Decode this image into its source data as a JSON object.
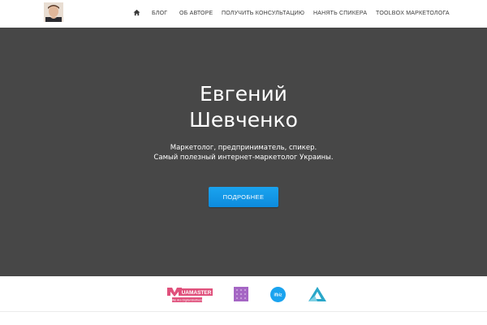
{
  "nav": {
    "home_icon": "home-icon",
    "items": [
      {
        "label": "БЛОГ"
      },
      {
        "label": "ОБ АВТОРЕ"
      },
      {
        "label": "ПОЛУЧИТЬ КОНСУЛЬТАЦИЮ"
      },
      {
        "label": "НАНЯТЬ СПИКЕРА"
      },
      {
        "label": "TOOLBOX МАРКЕТОЛОГА"
      }
    ]
  },
  "hero": {
    "title_line1": "Евгений",
    "title_line2": "Шевченко",
    "subtitle_line1": "Маркетолог, предприниматель, спикер.",
    "subtitle_line2": "Самый полезный интернет-маркетолог Украины.",
    "button_label": "ПОДРОБНЕЕ",
    "background_color": "#474747",
    "button_color": "#1597e5"
  },
  "partners": {
    "logos": [
      {
        "name": "uamaster-logo",
        "text": "UAMASTER",
        "tagline": "We Are Digital Brothers",
        "color": "#e0517c"
      },
      {
        "name": "purple-grid-logo",
        "color": "#a566c4"
      },
      {
        "name": "ifbiz-logo",
        "text": "ifbiz",
        "color": "#1aa3ef"
      },
      {
        "name": "triangle-logo",
        "color": "#2aa7c9"
      }
    ]
  }
}
